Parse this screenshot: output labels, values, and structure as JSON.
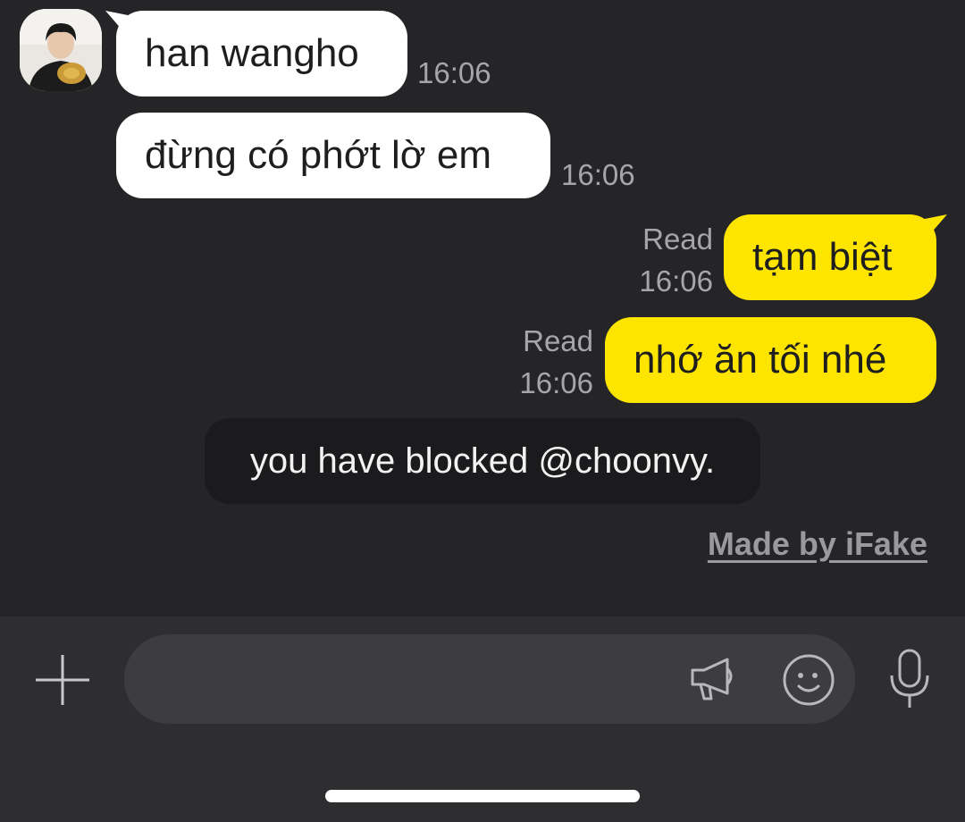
{
  "contact": {
    "name_avatar_icon": "profile-photo"
  },
  "messages": [
    {
      "direction": "incoming",
      "text": "han wangho",
      "time": "16:06"
    },
    {
      "direction": "incoming",
      "text": "đừng có phớt lờ em",
      "time": "16:06"
    },
    {
      "direction": "outgoing",
      "text": "tạm biệt",
      "status": "Read",
      "time": "16:06"
    },
    {
      "direction": "outgoing",
      "text": "nhớ ăn tối nhé",
      "status": "Read",
      "time": "16:06"
    }
  ],
  "system_notice": "you have blocked @choonvy.",
  "watermark": "Made by iFake",
  "input": {
    "value": "",
    "placeholder": ""
  },
  "icons": {
    "attach": "plus-icon",
    "shout": "megaphone-icon",
    "emoticon": "emoji-icon",
    "voice": "microphone-icon"
  },
  "colors": {
    "background": "#252528",
    "incoming_bubble": "#ffffff",
    "outgoing_bubble": "#fee500",
    "system_bubble": "#1b1b1d",
    "input_bar": "#2e2e30"
  }
}
